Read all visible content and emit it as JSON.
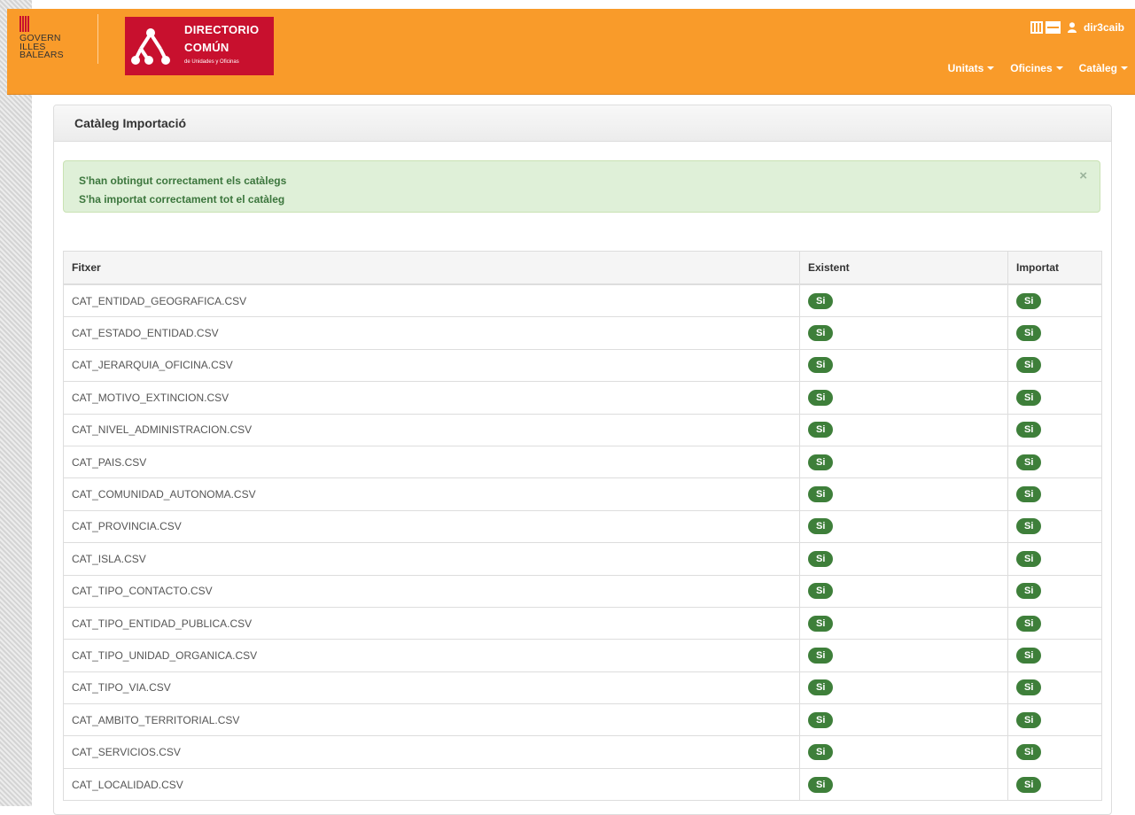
{
  "header": {
    "govern_logo": {
      "lines": [
        "GOVERN",
        "ILLES",
        "BALEARS"
      ]
    },
    "directory_logo": {
      "line1": "DIRECTORIO",
      "line2": "COMÚN",
      "tagline": "de Unidades y Oficinas"
    },
    "username": "dir3caib",
    "nav": [
      {
        "label": "Unitats"
      },
      {
        "label": "Oficines"
      },
      {
        "label": "Catàleg"
      }
    ],
    "accent_color": "#f99b2a",
    "brand_red": "#c8102e"
  },
  "panel": {
    "title": "Catàleg Importació",
    "alert": {
      "messages": [
        "S'han obtingut correctament els catàlegs",
        "S'ha importat correctament tot el catàleg"
      ],
      "close_glyph": "×",
      "color": "#dff0d8"
    },
    "table": {
      "headers": [
        "Fitxer",
        "Existent",
        "Importat"
      ],
      "rows": [
        {
          "file": "CAT_ENTIDAD_GEOGRAFICA.CSV",
          "existent": "Si",
          "importat": "Si"
        },
        {
          "file": "CAT_ESTADO_ENTIDAD.CSV",
          "existent": "Si",
          "importat": "Si"
        },
        {
          "file": "CAT_JERARQUIA_OFICINA.CSV",
          "existent": "Si",
          "importat": "Si"
        },
        {
          "file": "CAT_MOTIVO_EXTINCION.CSV",
          "existent": "Si",
          "importat": "Si"
        },
        {
          "file": "CAT_NIVEL_ADMINISTRACION.CSV",
          "existent": "Si",
          "importat": "Si"
        },
        {
          "file": "CAT_PAIS.CSV",
          "existent": "Si",
          "importat": "Si"
        },
        {
          "file": "CAT_COMUNIDAD_AUTONOMA.CSV",
          "existent": "Si",
          "importat": "Si"
        },
        {
          "file": "CAT_PROVINCIA.CSV",
          "existent": "Si",
          "importat": "Si"
        },
        {
          "file": "CAT_ISLA.CSV",
          "existent": "Si",
          "importat": "Si"
        },
        {
          "file": "CAT_TIPO_CONTACTO.CSV",
          "existent": "Si",
          "importat": "Si"
        },
        {
          "file": "CAT_TIPO_ENTIDAD_PUBLICA.CSV",
          "existent": "Si",
          "importat": "Si"
        },
        {
          "file": "CAT_TIPO_UNIDAD_ORGANICA.CSV",
          "existent": "Si",
          "importat": "Si"
        },
        {
          "file": "CAT_TIPO_VIA.CSV",
          "existent": "Si",
          "importat": "Si"
        },
        {
          "file": "CAT_AMBITO_TERRITORIAL.CSV",
          "existent": "Si",
          "importat": "Si"
        },
        {
          "file": "CAT_SERVICIOS.CSV",
          "existent": "Si",
          "importat": "Si"
        },
        {
          "file": "CAT_LOCALIDAD.CSV",
          "existent": "Si",
          "importat": "Si"
        }
      ],
      "badge_color": "#3e7f3a"
    }
  },
  "icons": {
    "view_toggle": "layout-columns-icon",
    "user": "user-icon",
    "close": "close-icon",
    "dropdown": "caret-down-icon",
    "govern_flag": "flag-icon",
    "directory_tree": "tree-network-icon"
  }
}
